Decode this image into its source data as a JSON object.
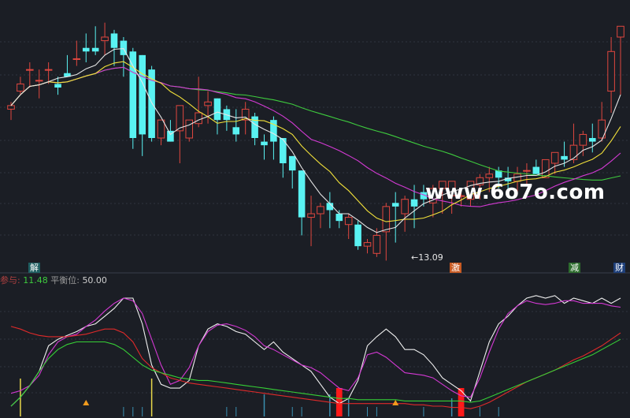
{
  "colors": {
    "background": "#1b1e25",
    "grid": "#2f343f",
    "candle_up": "#e0473f",
    "candle_down": "#59f2f2",
    "ma_white": "#e6e6e6",
    "ma_yellow": "#f2e13a",
    "ma_magenta": "#d43ad4",
    "ma_green": "#3ecb3e",
    "osc_red": "#e02a2a",
    "osc_green": "#36d036",
    "osc_magenta": "#d338d3",
    "osc_white": "#f0f0f0",
    "vbar_yellow": "#e8d84a",
    "vbar_red": "#ff1a1a",
    "vbar_blue": "#3a8fb0",
    "marker_orange": "#f29b1d"
  },
  "price_labels": {
    "low_label": "13.09"
  },
  "signal_tags": [
    {
      "text": "解",
      "color": "#ffffff",
      "bg": "#1f5f62"
    },
    {
      "text": "激",
      "color": "#ffffff",
      "bg": "#c85a22"
    },
    {
      "text": "减",
      "color": "#ffffff",
      "bg": "#2e6d2e"
    },
    {
      "text": "财",
      "color": "#ffffff",
      "bg": "#1e3f7a"
    }
  ],
  "indicator_info": {
    "name": "参与",
    "name_value": "11.48",
    "balance_label": "平衡位",
    "balance_value": "50.00"
  },
  "watermark": "www.6o7o.com",
  "chart_data": [
    {
      "type": "candlestick",
      "title": "",
      "ylim": [
        12.6,
        19.6
      ],
      "x": [
        1,
        2,
        3,
        4,
        5,
        6,
        7,
        8,
        9,
        10,
        11,
        12,
        13,
        14,
        15,
        16,
        17,
        18,
        19,
        20,
        21,
        22,
        23,
        24,
        25,
        26,
        27,
        28,
        29,
        30,
        31,
        32,
        33,
        34,
        35,
        36,
        37,
        38,
        39,
        40,
        41,
        42,
        43,
        44,
        45,
        46,
        47,
        48,
        49,
        50,
        51,
        52,
        53,
        54,
        55,
        56,
        57,
        58,
        59,
        60,
        61,
        62,
        63,
        64,
        65,
        66
      ],
      "open": [
        16.9,
        17.4,
        18.0,
        17.7,
        18.0,
        17.6,
        17.9,
        18.3,
        18.6,
        18.6,
        18.8,
        19.0,
        18.8,
        18.5,
        18.4,
        18.0,
        16.1,
        16.3,
        16.3,
        16.1,
        16.5,
        17.0,
        17.2,
        16.9,
        16.4,
        16.6,
        16.7,
        16.0,
        16.6,
        16.1,
        15.6,
        15.2,
        13.9,
        14.0,
        14.3,
        14.0,
        13.7,
        13.7,
        13.1,
        12.9,
        13.5,
        14.3,
        14.0,
        14.4,
        14.6,
        14.3,
        14.7,
        14.5,
        14.5,
        14.4,
        14.8,
        15.0,
        15.2,
        15.0,
        14.9,
        15.2,
        15.3,
        15.0,
        15.4,
        15.6,
        15.5,
        15.9,
        16.1,
        16.1,
        17.4,
        18.9
      ],
      "high": [
        17.1,
        17.8,
        18.2,
        18.0,
        18.2,
        17.8,
        18.4,
        18.8,
        19.0,
        19.2,
        19.3,
        19.1,
        18.9,
        18.6,
        18.4,
        18.1,
        16.6,
        16.6,
        16.8,
        16.5,
        17.8,
        17.4,
        17.2,
        17.0,
        16.9,
        17.1,
        16.8,
        16.2,
        16.7,
        16.1,
        15.6,
        15.2,
        14.5,
        14.3,
        14.6,
        14.1,
        14.0,
        13.8,
        13.3,
        13.6,
        14.3,
        14.6,
        14.5,
        14.8,
        14.8,
        14.8,
        14.9,
        14.9,
        14.7,
        14.9,
        15.1,
        15.3,
        15.3,
        15.3,
        15.3,
        15.4,
        15.5,
        15.5,
        15.7,
        16.0,
        16.5,
        16.3,
        16.5,
        17.1,
        18.9,
        19.1
      ],
      "low": [
        16.6,
        17.3,
        17.5,
        17.2,
        17.6,
        17.3,
        17.8,
        18.1,
        18.2,
        18.4,
        18.4,
        18.1,
        17.8,
        15.8,
        15.6,
        16.0,
        15.9,
        16.0,
        15.4,
        16.0,
        16.4,
        16.5,
        16.2,
        16.3,
        16.0,
        16.2,
        15.9,
        15.5,
        15.5,
        15.0,
        14.7,
        13.4,
        13.1,
        13.6,
        13.6,
        13.6,
        13.3,
        13.0,
        12.9,
        12.8,
        12.7,
        13.2,
        13.5,
        13.6,
        14.2,
        13.9,
        14.0,
        14.0,
        14.2,
        14.2,
        14.4,
        14.6,
        14.7,
        14.6,
        14.6,
        14.8,
        15.1,
        15.0,
        15.1,
        15.3,
        15.4,
        15.6,
        15.7,
        16.0,
        16.8,
        17.3
      ],
      "close": [
        17.0,
        17.6,
        18.0,
        17.7,
        18.0,
        17.5,
        17.8,
        18.3,
        18.5,
        18.5,
        18.9,
        18.6,
        18.4,
        16.1,
        16.2,
        16.1,
        16.6,
        16.0,
        17.0,
        16.6,
        16.8,
        17.1,
        16.6,
        16.6,
        16.2,
        16.9,
        16.1,
        15.9,
        16.0,
        15.4,
        15.2,
        13.9,
        14.0,
        14.2,
        14.1,
        13.8,
        13.9,
        13.1,
        13.2,
        13.4,
        14.2,
        14.2,
        14.4,
        14.2,
        14.4,
        14.7,
        14.9,
        14.9,
        14.5,
        14.9,
        15.0,
        15.1,
        15.0,
        14.9,
        15.1,
        15.2,
        15.1,
        15.5,
        15.7,
        15.5,
        15.9,
        16.2,
        16.0,
        16.6,
        18.5,
        19.2
      ]
    },
    {
      "type": "line",
      "title": "",
      "ylim": [
        0,
        100
      ],
      "x": [
        1,
        2,
        3,
        4,
        5,
        6,
        7,
        8,
        9,
        10,
        11,
        12,
        13,
        14,
        15,
        16,
        17,
        18,
        19,
        20,
        21,
        22,
        23,
        24,
        25,
        26,
        27,
        28,
        29,
        30,
        31,
        32,
        33,
        34,
        35,
        36,
        37,
        38,
        39,
        40,
        41,
        42,
        43,
        44,
        45,
        46,
        47,
        48,
        49,
        50,
        51,
        52,
        53,
        54,
        55,
        56,
        57,
        58,
        59,
        60,
        61,
        62,
        63,
        64,
        65,
        66
      ],
      "series": [
        {
          "key": "white",
          "values": [
            8,
            15,
            24,
            35,
            55,
            60,
            63,
            66,
            70,
            72,
            78,
            84,
            92,
            92,
            72,
            40,
            25,
            22,
            22,
            28,
            55,
            68,
            72,
            70,
            66,
            64,
            58,
            52,
            58,
            50,
            45,
            40,
            35,
            25,
            15,
            10,
            14,
            28,
            55,
            62,
            68,
            62,
            52,
            52,
            48,
            40,
            30,
            25,
            20,
            12,
            35,
            58,
            72,
            78,
            86,
            92,
            94,
            92,
            94,
            88,
            92,
            90,
            88,
            92,
            88,
            92
          ]
        },
        {
          "key": "magenta",
          "values": [
            18,
            20,
            24,
            32,
            48,
            58,
            62,
            64,
            70,
            75,
            82,
            88,
            92,
            90,
            80,
            60,
            40,
            25,
            28,
            38,
            55,
            66,
            71,
            72,
            70,
            67,
            62,
            55,
            52,
            48,
            44,
            40,
            38,
            34,
            28,
            22,
            20,
            30,
            48,
            50,
            46,
            40,
            34,
            33,
            32,
            30,
            25,
            20,
            16,
            15,
            30,
            50,
            68,
            80,
            86,
            90,
            88,
            87,
            88,
            90,
            90,
            88,
            88,
            88,
            86,
            85
          ]
        },
        {
          "key": "red",
          "values": [
            70,
            68,
            65,
            63,
            62,
            62,
            62,
            63,
            64,
            66,
            68,
            68,
            65,
            58,
            45,
            38,
            34,
            30,
            28,
            26,
            25,
            24,
            23,
            22,
            21,
            20,
            19,
            18,
            17,
            16,
            15,
            14,
            13,
            12,
            11,
            10,
            10,
            10,
            10,
            10,
            10,
            10,
            10,
            9,
            9,
            8,
            8,
            7,
            7,
            6,
            8,
            11,
            15,
            19,
            23,
            27,
            30,
            33,
            36,
            40,
            44,
            47,
            51,
            55,
            60,
            65
          ]
        },
        {
          "key": "green",
          "values": [
            8,
            15,
            24,
            35,
            45,
            52,
            56,
            58,
            58,
            58,
            58,
            56,
            52,
            46,
            40,
            36,
            34,
            32,
            30,
            29,
            28,
            28,
            27,
            26,
            25,
            24,
            23,
            22,
            21,
            20,
            19,
            18,
            17,
            16,
            15,
            14,
            14,
            13,
            13,
            13,
            13,
            13,
            12,
            12,
            12,
            12,
            12,
            12,
            12,
            11,
            12,
            15,
            18,
            21,
            24,
            27,
            30,
            33,
            36,
            39,
            42,
            45,
            48,
            52,
            56,
            60
          ]
        }
      ]
    }
  ]
}
